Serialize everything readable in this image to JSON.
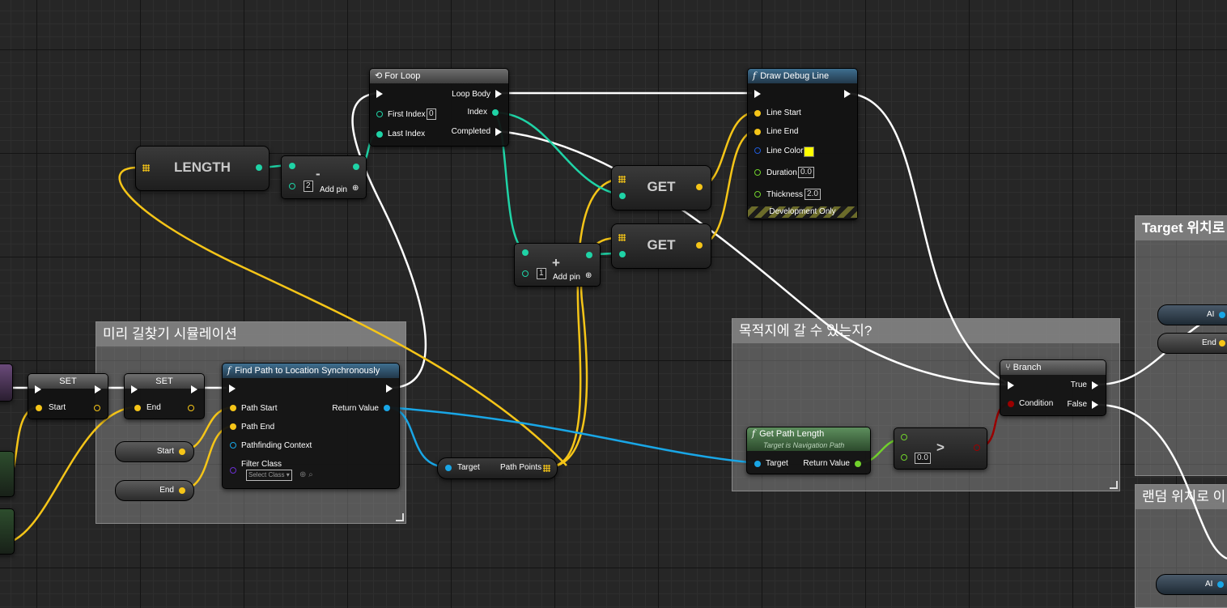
{
  "comments": {
    "path_sim": "미리 길찾기 시뮬레이션",
    "can_reach": "목적지에 갈 수 있는지?",
    "target_move": "Target 위치로",
    "random_move": "랜덤 위치로 이"
  },
  "nodes": {
    "for_loop": {
      "title": "For Loop",
      "loop_body": "Loop Body",
      "first_index": "First Index",
      "first_index_value": "0",
      "index": "Index",
      "last_index": "Last Index",
      "completed": "Completed"
    },
    "draw_debug_line": {
      "title": "Draw Debug Line",
      "line_start": "Line Start",
      "line_end": "Line End",
      "line_color": "Line Color",
      "duration": "Duration",
      "duration_value": "0.0",
      "thickness": "Thickness",
      "thickness_value": "2.0",
      "development_only": "Development Only"
    },
    "length": {
      "label": "LENGTH"
    },
    "subtract": {
      "symbol": "-",
      "value": "2",
      "add_pin": "Add pin"
    },
    "add": {
      "symbol": "+",
      "value": "1",
      "add_pin": "Add pin"
    },
    "get1": {
      "label": "GET"
    },
    "get2": {
      "label": "GET"
    },
    "set1": {
      "title": "SET",
      "pin": "Start"
    },
    "set2": {
      "title": "SET",
      "pin": "End"
    },
    "var_start": {
      "label": "Start"
    },
    "var_end": {
      "label": "End"
    },
    "find_path": {
      "title": "Find Path to Location Synchronously",
      "path_start": "Path Start",
      "path_end": "Path End",
      "pathfinding_context": "Pathfinding Context",
      "filter_class": "Filter Class",
      "select_class": "Select Class",
      "return_value": "Return Value"
    },
    "path_points": {
      "target": "Target",
      "path_points": "Path Points"
    },
    "get_path_length": {
      "title": "Get Path Length",
      "subtitle": "Target is Navigation Path",
      "target": "Target",
      "return_value": "Return Value"
    },
    "greater": {
      "symbol": ">",
      "value": "0.0"
    },
    "branch": {
      "title": "Branch",
      "true": "True",
      "condition": "Condition",
      "false": "False"
    },
    "right_vars": {
      "ai1": "AI",
      "end": "End",
      "ai2": "AI"
    }
  },
  "colors": {
    "exec": "#ffffff",
    "vector": "#f5c518",
    "integer": "#1fd3a6",
    "object": "#19a6e6",
    "bool": "#9a0000",
    "float": "#71d12c",
    "linear_color": "#1f5bd8",
    "class": "#6a2fd0"
  }
}
